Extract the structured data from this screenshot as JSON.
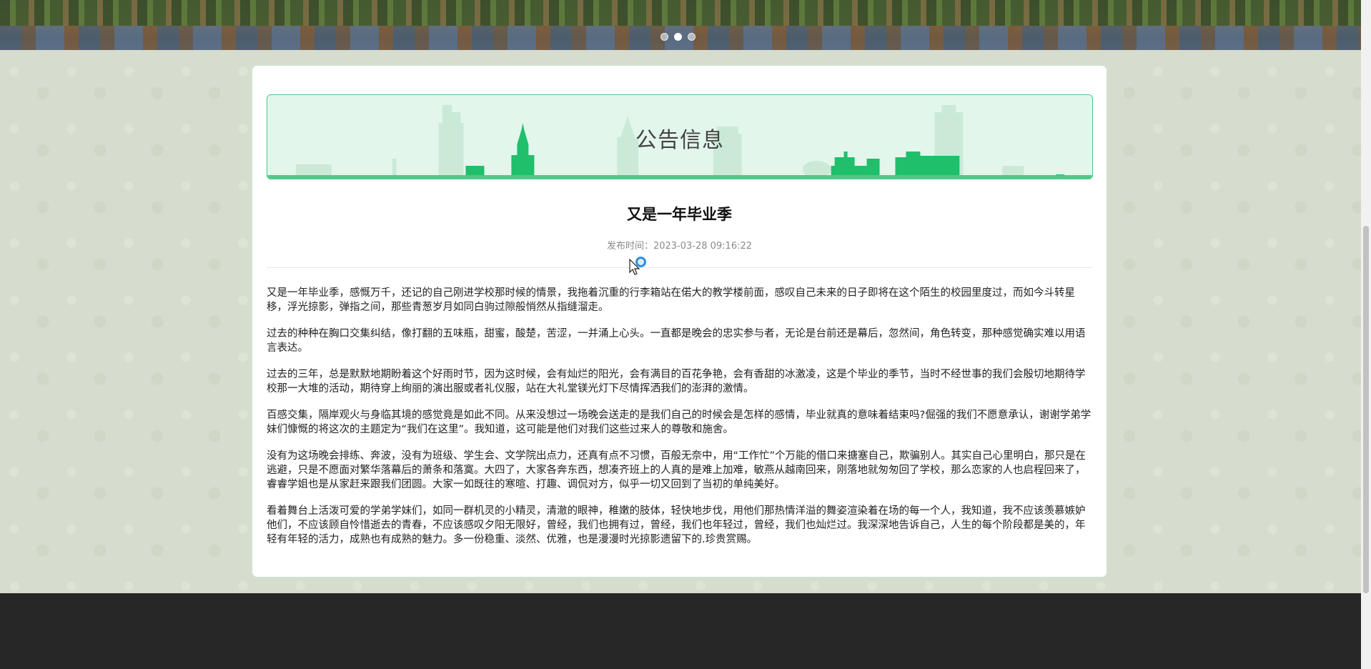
{
  "carousel": {
    "slide_count": 3,
    "active_index": 1
  },
  "notice": {
    "heading": "公告信息"
  },
  "article": {
    "title": "又是一年毕业季",
    "publish_time": "发布时间：2023-03-28 09:16:22",
    "paragraphs": [
      "又是一年毕业季，感慨万千，还记的自己刚进学校那时候的情景，我拖着沉重的行李箱站在偌大的教学楼前面，感叹自己未来的日子即将在这个陌生的校园里度过，而如今斗转星移，浮光掠影，弹指之间，那些青葱岁月如同白驹过隙般悄然从指缝溜走。",
      "过去的种种在胸口交集纠结，像打翻的五味瓶，甜蜜，酸楚，苦涩，一并涌上心头。一直都是晚会的忠实参与者，无论是台前还是幕后，忽然间，角色转变，那种感觉确实难以用语言表达。",
      "过去的三年，总是默默地期盼着这个好雨时节，因为这时候，会有灿烂的阳光，会有满目的百花争艳，会有香甜的冰激凌，这是个毕业的季节，当时不经世事的我们会殷切地期待学校那一大堆的活动，期待穿上绚丽的演出服或者礼仪服，站在大礼堂镁光灯下尽情挥洒我们的澎湃的激情。",
      "百感交集，隔岸观火与身临其境的感觉竟是如此不同。从来没想过一场晚会送走的是我们自己的时候会是怎样的感情，毕业就真的意味着结束吗?倔强的我们不愿意承认，谢谢学弟学妹们慷慨的将这次的主题定为“我们在这里”。我知道，这可能是他们对我们这些过来人的尊敬和施舍。",
      "没有为这场晚会排练、奔波，没有为班级、学生会、文学院出点力，还真有点不习惯，百般无奈中，用“工作忙”个万能的借口来搪塞自己，欺骗别人。其实自己心里明白，那只是在逃避，只是不愿面对繁华落幕后的萧条和落寞。大四了，大家各奔东西，想凑齐班上的人真的是难上加难，敏燕从越南回来，刚落地就匆匆回了学校，那么恋家的人也启程回来了，睿睿学姐也是从家赶来跟我们团圆。大家一如既往的寒暄、打趣、调侃对方，似乎一切又回到了当初的单纯美好。",
      "看着舞台上活泼可爱的学弟学妹们，如同一群机灵的小精灵，清澈的眼神，稚嫩的肢体，轻快地步伐，用他们那热情洋溢的舞姿渲染着在场的每一个人，我知道，我不应该羡慕嫉妒他们，不应该顾自怜惜逝去的青春，不应该感叹夕阳无限好，曾经，我们也拥有过，曾经，我们也年轻过，曾经，我们也灿烂过。我深深地告诉自己，人生的每个阶段都是美的，年轻有年轻的活力，成熟也有成熟的魅力。多一份稳重、淡然、优雅，也是漫漫时光掠影遗留下的.珍贵赏赐。"
    ]
  },
  "colors": {
    "header_accent": "#4fc889",
    "header_bg": "#e3f6ec",
    "footer_bg": "#272727",
    "page_bg": "#d7ddce"
  }
}
